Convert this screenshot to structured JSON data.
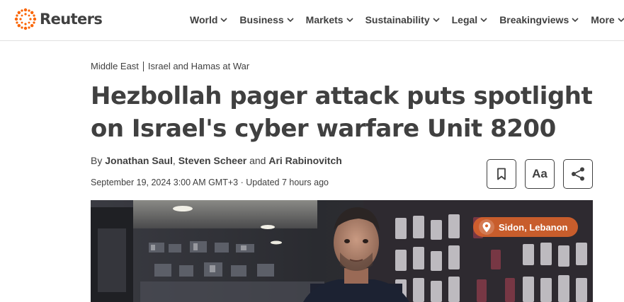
{
  "brand": {
    "name": "Reuters",
    "accent": "#fa6400"
  },
  "nav": {
    "items": [
      {
        "label": "World"
      },
      {
        "label": "Business"
      },
      {
        "label": "Markets"
      },
      {
        "label": "Sustainability"
      },
      {
        "label": "Legal"
      },
      {
        "label": "Breakingviews"
      },
      {
        "label": "More"
      }
    ]
  },
  "breadcrumbs": [
    "Middle East",
    "Israel and Hamas at War"
  ],
  "article": {
    "headline": "Hezbollah pager attack puts spotlight on Israel's cyber warfare Unit 8200",
    "byline": {
      "prefix": "By",
      "authors": [
        "Jonathan Saul",
        "Steven Scheer",
        "Ari Rabinovitch"
      ],
      "separator": ",",
      "conjunction": "and"
    },
    "dateline": "September 19, 2024 3:00 AM GMT+3 · Updated 7 hours ago"
  },
  "tools": {
    "bookmark_icon": "bookmark-icon",
    "text_size_label": "Aa",
    "share_icon": "share-icon"
  },
  "hero": {
    "location_label": "Sidon, Lebanon",
    "location_icon": "map-pin-icon",
    "badge_color": "#d6622c"
  }
}
